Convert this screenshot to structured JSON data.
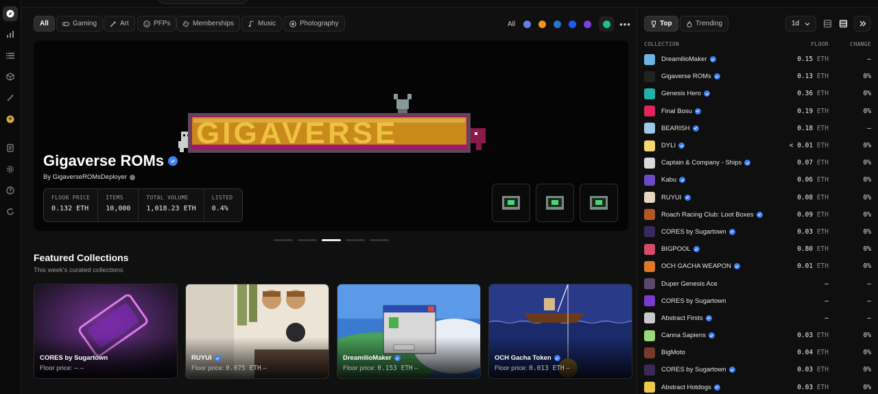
{
  "filters": {
    "chips": [
      {
        "label": "All",
        "icon": "none",
        "active": true
      },
      {
        "label": "Gaming",
        "icon": "gamepad-icon"
      },
      {
        "label": "Art",
        "icon": "brush-icon"
      },
      {
        "label": "PFPs",
        "icon": "face-icon"
      },
      {
        "label": "Memberships",
        "icon": "ticket-icon"
      },
      {
        "label": "Music",
        "icon": "music-icon"
      },
      {
        "label": "Photography",
        "icon": "camera-icon"
      }
    ],
    "chains_label": "All",
    "chain_colors": [
      "#627eea",
      "#f7931a",
      "#2775ca",
      "#1e5cf5",
      "#7b3fe4",
      "#16c784"
    ],
    "more_label": "•••"
  },
  "hero": {
    "title": "Gigaverse ROMs",
    "by": "By GigaverseROMsDeployer",
    "stats": [
      {
        "label": "FLOOR PRICE",
        "value": "0.132 ETH"
      },
      {
        "label": "ITEMS",
        "value": "10,000"
      },
      {
        "label": "TOTAL VOLUME",
        "value": "1,018.23 ETH"
      },
      {
        "label": "LISTED",
        "value": "0.4%"
      }
    ],
    "active_slide": 3,
    "slide_count": 5
  },
  "featured": {
    "title": "Featured Collections",
    "subtitle": "This week's curated collections",
    "floor_label": "Floor price:",
    "cards": [
      {
        "name": "CORES by Sugartown",
        "verified": false,
        "floor": "–",
        "trail": "–"
      },
      {
        "name": "RUYUI",
        "verified": true,
        "floor": "0.075 ETH",
        "trail": "–"
      },
      {
        "name": "DreamilioMaker",
        "verified": true,
        "floor": "0.153 ETH",
        "trail": "–"
      },
      {
        "name": "OCH Gacha Token",
        "verified": true,
        "floor": "0.013 ETH",
        "trail": "–"
      }
    ]
  },
  "panel": {
    "tabs": [
      {
        "label": "Top",
        "icon": "trophy-icon",
        "active": true
      },
      {
        "label": "Trending",
        "icon": "fire-icon",
        "active": false
      }
    ],
    "period": "1d",
    "headers": {
      "collection": "COLLECTION",
      "floor": "FLOOR",
      "change": "CHANGE"
    },
    "rows": [
      {
        "name": "DreamilioMaker",
        "verified": true,
        "floor": "0.15",
        "unit": "ETH",
        "change": "–",
        "color": "#6fb3e0"
      },
      {
        "name": "Gigaverse ROMs",
        "verified": true,
        "floor": "0.13",
        "unit": "ETH",
        "change": "0%",
        "color": "#222222"
      },
      {
        "name": "Genesis Hero",
        "verified": true,
        "floor": "0.36",
        "unit": "ETH",
        "change": "0%",
        "color": "#20b2aa"
      },
      {
        "name": "Final Bosu",
        "verified": true,
        "floor": "0.19",
        "unit": "ETH",
        "change": "0%",
        "color": "#e0245e"
      },
      {
        "name": "BEARISH",
        "verified": true,
        "floor": "0.18",
        "unit": "ETH",
        "change": "–",
        "color": "#9ec9e6"
      },
      {
        "name": "DYLI",
        "verified": true,
        "floor": "< 0.01",
        "unit": "ETH",
        "change": "0%",
        "color": "#f5d76e"
      },
      {
        "name": "Captain & Company - Ships",
        "verified": true,
        "floor": "0.07",
        "unit": "ETH",
        "change": "0%",
        "color": "#d9d9d9"
      },
      {
        "name": "Kabu",
        "verified": true,
        "floor": "0.06",
        "unit": "ETH",
        "change": "0%",
        "color": "#6a4bc4"
      },
      {
        "name": "RUYUI",
        "verified": true,
        "floor": "0.08",
        "unit": "ETH",
        "change": "0%",
        "color": "#e8d6c4"
      },
      {
        "name": "Roach Racing Club: Loot Boxes",
        "verified": true,
        "floor": "0.09",
        "unit": "ETH",
        "change": "0%",
        "color": "#b5562a"
      },
      {
        "name": "CORES by Sugartown",
        "verified": true,
        "floor": "0.03",
        "unit": "ETH",
        "change": "0%",
        "color": "#3a2a5c"
      },
      {
        "name": "BIGPOOL",
        "verified": true,
        "floor": "0.80",
        "unit": "ETH",
        "change": "0%",
        "color": "#d64a6a"
      },
      {
        "name": "OCH GACHA WEAPON",
        "verified": true,
        "floor": "0.01",
        "unit": "ETH",
        "change": "0%",
        "color": "#e0782a"
      },
      {
        "name": "Duper Genesis Ace",
        "verified": false,
        "floor": "–",
        "unit": "",
        "change": "–",
        "color": "#5a4a6a"
      },
      {
        "name": "CORES by Sugartown",
        "verified": false,
        "floor": "–",
        "unit": "",
        "change": "–",
        "color": "#7a3ad0"
      },
      {
        "name": "Abstract Firsts",
        "verified": true,
        "floor": "–",
        "unit": "",
        "change": "–",
        "color": "#c9c9c9"
      },
      {
        "name": "Canna Sapiens",
        "verified": true,
        "floor": "0.03",
        "unit": "ETH",
        "change": "0%",
        "color": "#9ad87a"
      },
      {
        "name": "BigMoto",
        "verified": false,
        "floor": "0.04",
        "unit": "ETH",
        "change": "0%",
        "color": "#7a3a2a"
      },
      {
        "name": "CORES by Sugartown",
        "verified": true,
        "floor": "0.03",
        "unit": "ETH",
        "change": "0%",
        "color": "#3a2a5c"
      },
      {
        "name": "Abstract Hotdogs",
        "verified": true,
        "floor": "0.03",
        "unit": "ETH",
        "change": "0%",
        "color": "#f0c84a"
      }
    ]
  }
}
